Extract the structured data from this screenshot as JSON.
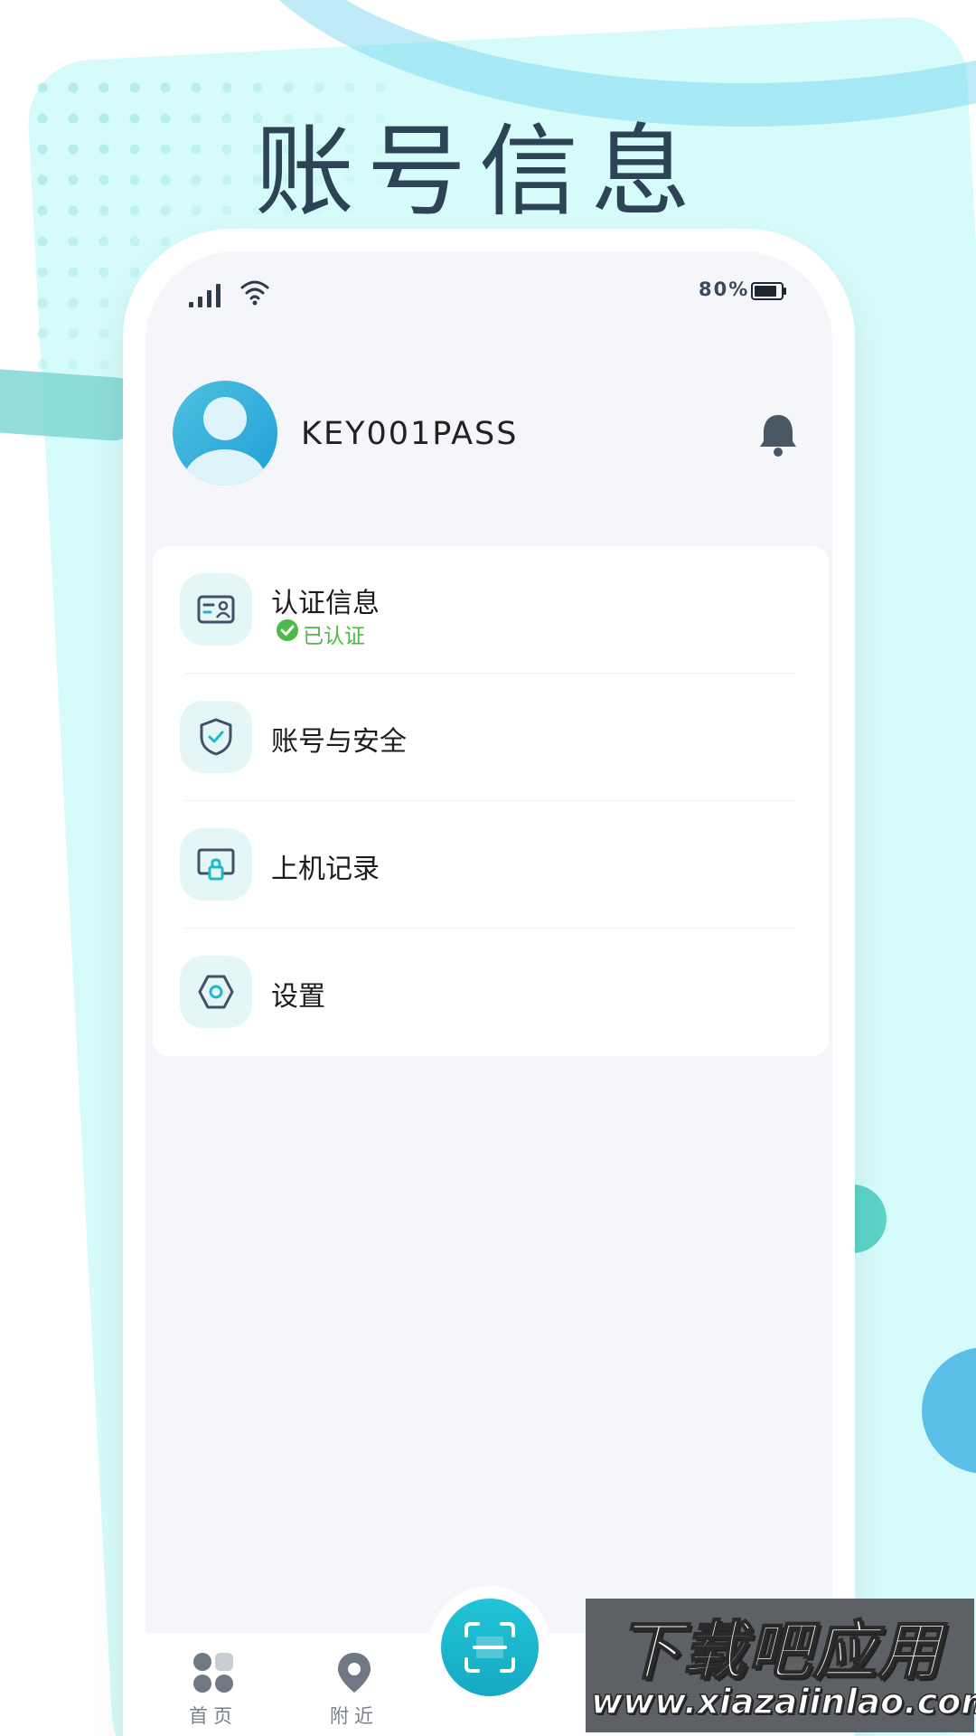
{
  "colors": {
    "accent": "#1fb8cf",
    "verified_green": "#4cba46",
    "title_color": "#2d4356",
    "screen_bg": "#f4f6f9",
    "backdrop": "#d6fbfb"
  },
  "page_title": "账号信息",
  "status_bar": {
    "battery_percent": "80%",
    "icons": [
      "signal-icon",
      "wifi-icon",
      "battery-icon"
    ]
  },
  "profile": {
    "username": "KEY001PASS",
    "avatar_icon": "user-avatar-icon",
    "notification_icon": "bell-icon"
  },
  "menu": {
    "items": [
      {
        "label": "认证信息",
        "icon": "id-card-icon",
        "status": "已认证",
        "status_icon": "check-circle-icon"
      },
      {
        "label": "账号与安全",
        "icon": "shield-check-icon"
      },
      {
        "label": "上机记录",
        "icon": "monitor-lock-icon"
      },
      {
        "label": "设置",
        "icon": "hexagon-settings-icon"
      }
    ]
  },
  "tabbar": {
    "tabs": [
      {
        "label": "首页",
        "icon": "grid-home-icon"
      },
      {
        "label": "附近",
        "icon": "location-pin-icon"
      }
    ],
    "center_button_icon": "scan-icon"
  },
  "watermark": {
    "title": "下载吧应用",
    "url": "www.xiazaiinlao.com"
  }
}
